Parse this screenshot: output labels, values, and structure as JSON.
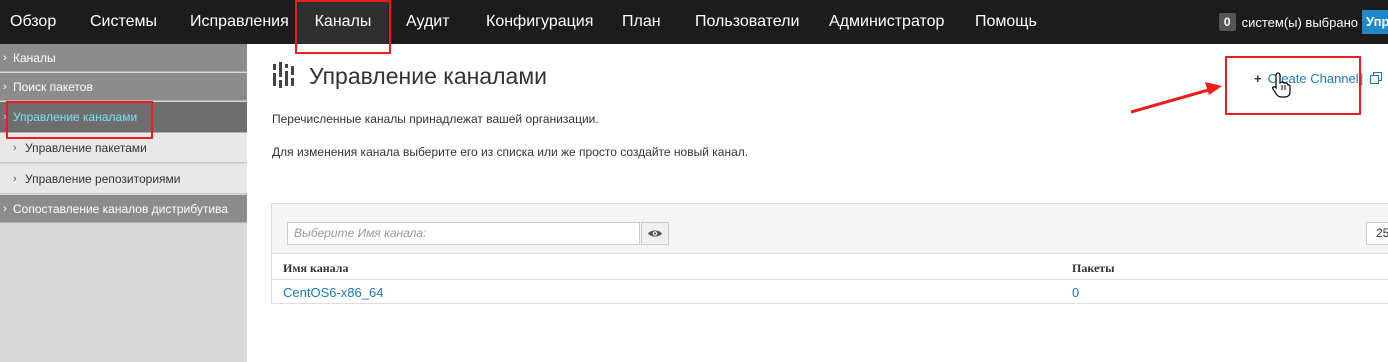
{
  "topnav": {
    "items": [
      {
        "label": "Обзор"
      },
      {
        "label": "Системы"
      },
      {
        "label": "Исправления"
      },
      {
        "label": "Каналы"
      },
      {
        "label": "Аудит"
      },
      {
        "label": "Конфигурация"
      },
      {
        "label": "План"
      },
      {
        "label": "Пользователи"
      },
      {
        "label": "Администратор"
      },
      {
        "label": "Помощь"
      }
    ],
    "active": "Каналы",
    "selected_count": "0",
    "selected_text": "систем(ы) выбрано",
    "manage_button": "Упр"
  },
  "sidebar": {
    "items": [
      {
        "label": "Каналы",
        "level": 1
      },
      {
        "label": "Поиск пакетов",
        "level": 1
      },
      {
        "label": "Управление каналами",
        "level": 1,
        "active": true
      },
      {
        "label": "Управление пакетами",
        "level": 2
      },
      {
        "label": "Управление репозиториями",
        "level": 2
      },
      {
        "label": "Сопоставление каналов дистрибутива",
        "level": 1
      }
    ]
  },
  "main": {
    "title": "Управление каналами",
    "create_channel": "Create Channel",
    "separator": "|",
    "intro_1": "Перечисленные каналы принадлежат вашей организации.",
    "intro_2": "Для изменения канала выберите его из списка или же просто создайте новый канал.",
    "filter_placeholder": "Выберите Имя канала:",
    "page_size": "25",
    "table": {
      "columns": [
        "Имя канала",
        "Пакеты"
      ],
      "rows": [
        {
          "name": "CentOS6-x86_64",
          "packages": "0"
        }
      ]
    }
  },
  "colors": {
    "nav_bg": "#1c1c1c",
    "accent": "#1b7bb8",
    "active_sidebar_text": "#7de0f0",
    "annotation": "#ee1c1c"
  }
}
